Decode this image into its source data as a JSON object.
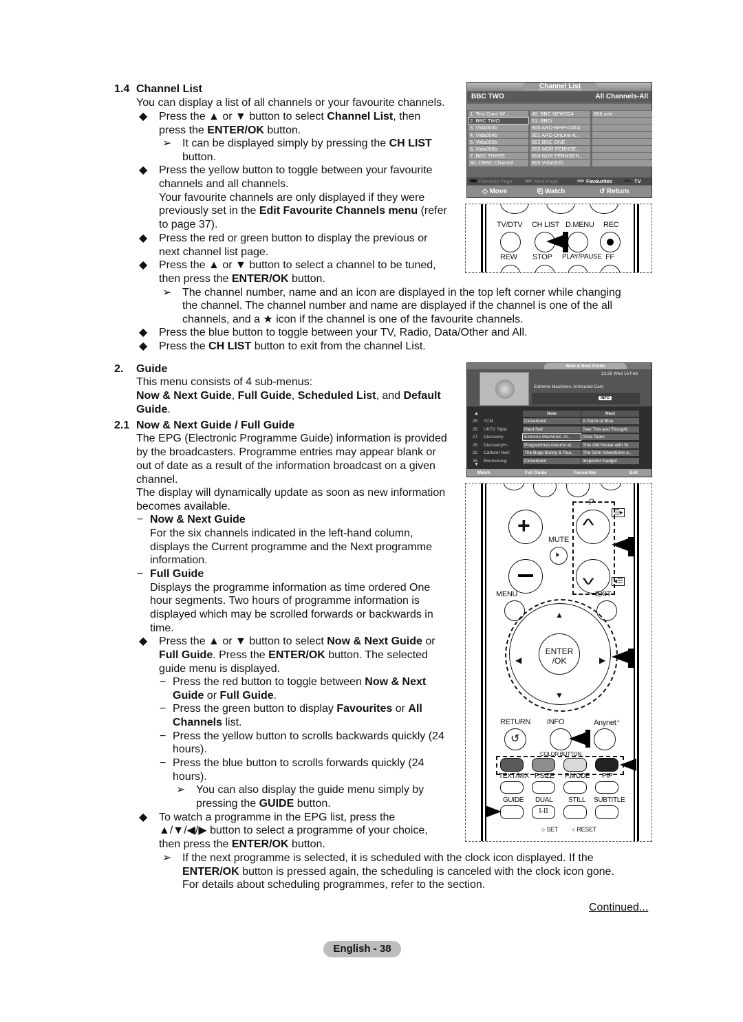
{
  "sections": {
    "channel_list": {
      "number": "1.4",
      "title": "Channel List",
      "intro": "You can display a list of all channels or your favourite channels.",
      "bullet1_a": "Press the ▲ or ▼ button to select ",
      "bullet1_b": "Channel List",
      "bullet1_c": ", then",
      "bullet1_d": "press the ",
      "bullet1_e": "ENTER/OK",
      "bullet1_f": " button.",
      "note1_a": "It can be displayed simply by pressing the ",
      "note1_b": "CH LIST",
      "note1_c": "button.",
      "bullet2_a": "Press the yellow button to toggle between your favourite",
      "bullet2_b": "channels and all channels.",
      "fav_a": "Your favourite channels are only displayed if they were",
      "fav_b": "previously set in the ",
      "fav_c": "Edit Favourite Channels menu",
      "fav_d": " (refer",
      "fav_e": "to page 37).",
      "bullet3_a": "Press the red or green button to display the previous or",
      "bullet3_b": "next channel list page.",
      "bullet4_a": "Press the ▲ or ▼ button to select a channel to be tuned,",
      "bullet4_b": "then press the ",
      "bullet4_c": "ENTER/OK",
      "bullet4_d": " button.",
      "note2_a": "The channel number, name and an icon are displayed in the top left corner while changing",
      "note2_b": "the channel. The channel number and name are displayed if the channel is one of the all",
      "note2_c": "channels, and a ★ icon if the channel is one of the favourite channels.",
      "bullet5": "Press the blue button to toggle between your TV, Radio, Data/Other and All.",
      "bullet6_a": "Press the ",
      "bullet6_b": "CH LIST",
      "bullet6_c": " button to exit from the channel List."
    },
    "guide": {
      "number": "2.",
      "title": "Guide",
      "intro": "This menu consists of 4 sub-menus:",
      "submenus_a": "Now & Next Guide",
      "submenus_b": ", ",
      "submenus_c": "Full Guide",
      "submenus_d": ", ",
      "submenus_e": "Scheduled List",
      "submenus_f": ", and ",
      "submenus_g": "Default",
      "submenus_h": "Guide",
      "submenus_i": "."
    },
    "now_next": {
      "number": "2.1",
      "title": "Now & Next Guide / Full Guide",
      "p1_a": "The EPG (Electronic Programme Guide) information is provided",
      "p1_b": "by the broadcasters. Programme entries may appear blank or",
      "p1_c": "out of date as a result of the information broadcast on a given",
      "p1_d": "channel.",
      "p2_a": "The display will dynamically update as soon as new information",
      "p2_b": "becomes available.",
      "nn_title": "Now & Next Guide",
      "nn_a": "For the six channels indicated in the left-hand column,",
      "nn_b": "displays the Current programme and the Next programme",
      "nn_c": "information.",
      "fg_title": "Full Guide",
      "fg_a": "Displays the programme information as time ordered One",
      "fg_b": "hour segments. Two hours of programme information is",
      "fg_c": "displayed which may be scrolled forwards or backwards in",
      "fg_d": "time.",
      "b1_a": "Press the ▲ or ▼ button to select ",
      "b1_b": "Now & Next Guide",
      "b1_c": " or",
      "b1_d": "Full Guide",
      "b1_e": ". Press the ",
      "b1_f": "ENTER/OK",
      "b1_g": " button. The selected",
      "b1_h": "guide menu is displayed.",
      "d1_a": "Press the red button to toggle between ",
      "d1_b": "Now & Next",
      "d1_c": "Guide",
      "d1_d": " or ",
      "d1_e": "Full Guide",
      "d1_f": ".",
      "d2_a": "Press the green button to display ",
      "d2_b": "Favourites",
      "d2_c": " or ",
      "d2_d": "All",
      "d2_e": "Channels",
      "d2_f": " list.",
      "d3_a": "Press the yellow button to scrolls backwards quickly (24",
      "d3_b": "hours).",
      "d4_a": "Press the blue button to scrolls forwards quickly (24",
      "d4_b": "hours).",
      "n1_a": "You can also display the guide menu simply by",
      "n1_b": "pressing the ",
      "n1_c": "GUIDE",
      "n1_d": " button.",
      "b2_a": "To watch a programme in the EPG list, press the",
      "b2_b": "▲/▼/◀/▶ button to select a programme of your choice,",
      "b2_c": "then press the ",
      "b2_d": "ENTER/OK",
      "b2_e": " button.",
      "n2_a": "If the next programme is selected, it is scheduled with the clock icon displayed. If the",
      "n2_b": "ENTER/OK",
      "n2_c": " button is pressed again, the scheduling is canceled with the clock icon gone.",
      "n2_d": "For details about scheduling programmes, refer to the section."
    }
  },
  "channel_list_screen": {
    "title": "Channel List",
    "current": "BBC TWO",
    "mode": "All Channels-All",
    "col1": [
      "1.  Test Card 'M'...",
      "2.  BBC TWO",
      "3.  Vida003b",
      "4.  Vida004b",
      "5.  Vida005b",
      "6.  Vida006b",
      "7.  BBC THREE",
      "30. CBBC Channel"
    ],
    "col2": [
      "40.  BBC NEWS24",
      "51.  BBCi",
      "800 ARD-MHP-DATA",
      "801 ARD-OnLine-K..",
      "802 BBC ONE",
      "803 MDR FERNSE..",
      "804 NDR FERNSEH..",
      "805 Vida002b"
    ],
    "col3": [
      "806 arte",
      "",
      "",
      "",
      "",
      "",
      "",
      ""
    ],
    "legend": [
      "Previous Page",
      "Next Page",
      "Favourites",
      "TV"
    ],
    "footer": [
      "◇ Move",
      "⎗ Watch",
      "↺ Return"
    ]
  },
  "epg_screen": {
    "title": "Now & Next Guide",
    "datetime": "13:28 Wed 16 Feb",
    "current_programme": "Extreme Machines: Armoured Cars",
    "info_badge": "INFO",
    "col_now": "Now",
    "col_next": "Next",
    "rows": [
      {
        "num": "25",
        "ch": "TCM",
        "now": "Closedown",
        "next": "A Patch of Blue"
      },
      {
        "num": "26",
        "ch": "UKTV Style",
        "now": "Hard Sell",
        "next": "Saw This and Thought.."
      },
      {
        "num": "27",
        "ch": "Discovery",
        "now": "Extreme Machines: Ar..",
        "next": "Time Team"
      },
      {
        "num": "28",
        "ch": "DiscoveryH..",
        "now": "Programmes resume at..",
        "next": "This Old House with St.."
      },
      {
        "num": "32",
        "ch": "Cartoon Nwk",
        "now": "The Bugs Bunny & Roa..",
        "next": "The Grim Adventures o.."
      },
      {
        "num": "35",
        "ch": "Boomerang",
        "now": "Closedown",
        "next": "Inspector Gadget"
      }
    ],
    "footer": [
      "Watch",
      "Full Guide",
      "Favourites",
      "Exit"
    ]
  },
  "remote1": {
    "labels": [
      "TV/DTV",
      "CH LIST",
      "D.MENU",
      "REC",
      "REW",
      "STOP",
      "PLAY/PAUSE",
      "FF"
    ]
  },
  "remote2": {
    "p_label": "P",
    "mute_label": "MUTE",
    "menu_label": "MENU",
    "exit_label": "EXIT",
    "enter_label_a": "ENTER",
    "enter_label_b": "/OK",
    "return_label": "RETURN",
    "info_label": "INFO",
    "anynet_label": "Anynet⁺",
    "color_button_label": "COLOR BUTTON",
    "row_labels": [
      "TEXT/MIX",
      "P.SIZE",
      "P.MODE",
      "PIP"
    ],
    "row2_labels": [
      "GUIDE",
      "DUAL",
      "STILL",
      "SUBTITLE"
    ],
    "dual_glyph": "I-II",
    "set_label": "SET",
    "reset_label": "RESET",
    "colors": [
      "#5a5a5a",
      "#8e8e8e",
      "#d9d9d9",
      "#222222"
    ]
  },
  "footer": {
    "continued": "Continued...",
    "page_label": "English - 38"
  }
}
